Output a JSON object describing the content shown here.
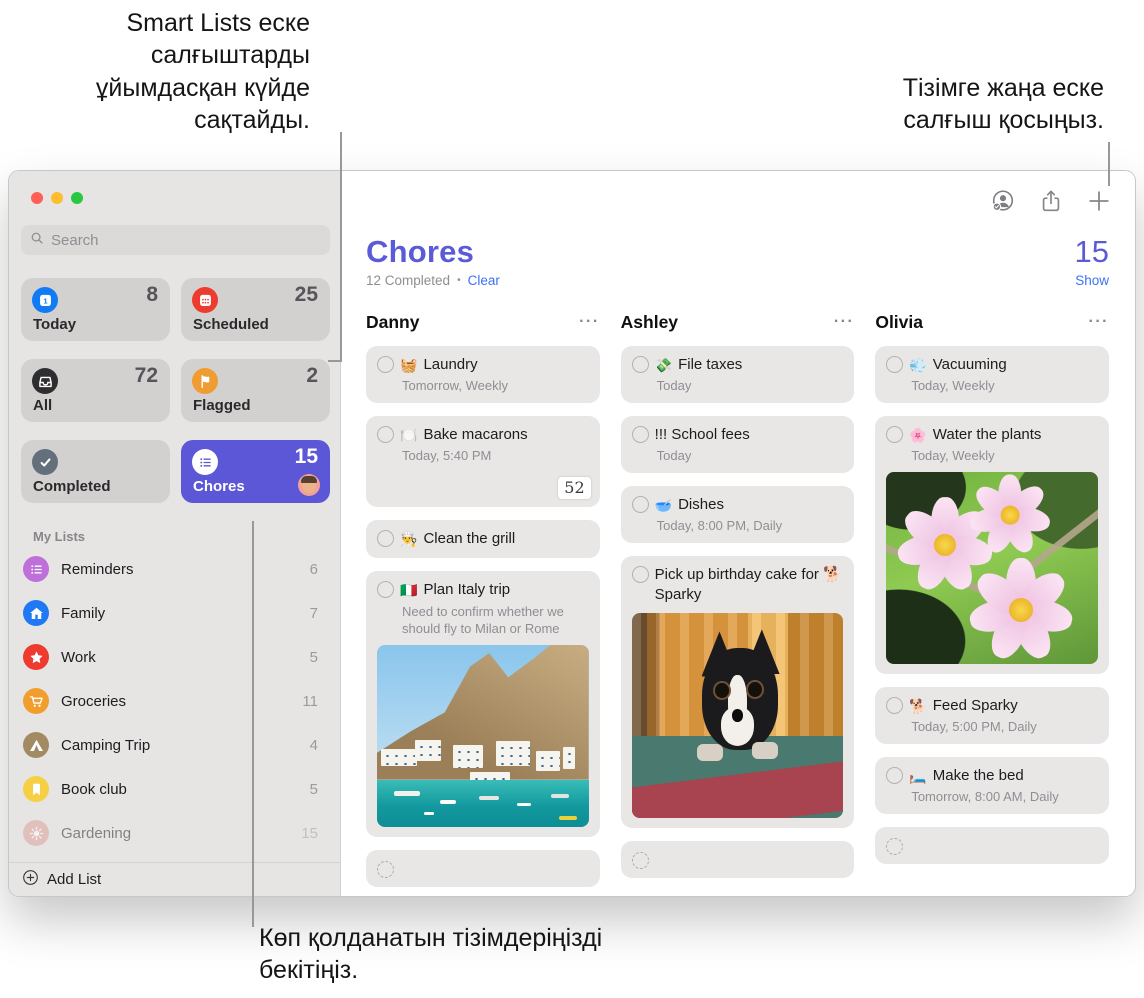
{
  "annotations": {
    "smart_lists": "Smart Lists еске салғыштарды ұйымдасқан күйде сақтайды.",
    "add_reminder": "Тізімге жаңа еске салғыш қосыңыз.",
    "pin_lists": "Көп қолданатын тізімдеріңізді бекітіңіз."
  },
  "colors": {
    "accent_indigo": "#5b57d6",
    "link_blue": "#3b72f2",
    "traffic": [
      "#ff5f57",
      "#febc2e",
      "#28c840"
    ]
  },
  "sidebar": {
    "search_placeholder": "Search",
    "smart_lists": [
      {
        "label": "Today",
        "count": "8",
        "color": "#107bf5",
        "icon": "calendar-today",
        "selected": false
      },
      {
        "label": "Scheduled",
        "count": "25",
        "color": "#ee3b2f",
        "icon": "calendar-grid",
        "selected": false
      },
      {
        "label": "All",
        "count": "72",
        "color": "#2e2e30",
        "icon": "tray",
        "selected": false
      },
      {
        "label": "Flagged",
        "count": "2",
        "color": "#ef9c33",
        "icon": "flag",
        "selected": false
      },
      {
        "label": "Completed",
        "count": "",
        "color": "#63707b",
        "icon": "check",
        "selected": false
      },
      {
        "label": "Chores",
        "count": "15",
        "color": "#5b57d6",
        "icon": "list",
        "selected": true
      }
    ],
    "my_lists_label": "My Lists",
    "my_lists": [
      {
        "label": "Reminders",
        "count": "6",
        "color": "#bf6fd9",
        "icon": "list",
        "faded": false
      },
      {
        "label": "Family",
        "count": "7",
        "color": "#2079f4",
        "icon": "house",
        "faded": false
      },
      {
        "label": "Work",
        "count": "5",
        "color": "#ee3b2f",
        "icon": "star",
        "faded": false
      },
      {
        "label": "Groceries",
        "count": "11",
        "color": "#f09f2e",
        "icon": "cart",
        "faded": false
      },
      {
        "label": "Camping Trip",
        "count": "4",
        "color": "#a28a63",
        "icon": "tent",
        "faded": false
      },
      {
        "label": "Book club",
        "count": "5",
        "color": "#f6cf45",
        "icon": "bookmark",
        "faded": false
      },
      {
        "label": "Gardening",
        "count": "15",
        "color": "#dd9c95",
        "icon": "sun",
        "faded": true
      }
    ],
    "add_list_label": "Add List"
  },
  "toolbar": {
    "icons": [
      "collaborate",
      "share",
      "add-reminder"
    ]
  },
  "header": {
    "title": "Chores",
    "completed_text": "12 Completed",
    "separator": "•",
    "clear_link": "Clear",
    "count": "15",
    "show_link": "Show"
  },
  "columns": [
    {
      "name": "Danny",
      "more": "···",
      "items": [
        {
          "emoji": "🧺",
          "title": "Laundry",
          "subtitle": "Tomorrow, Weekly"
        },
        {
          "emoji": "🍽️",
          "title": "Bake macarons",
          "subtitle": "Today, 5:40 PM",
          "badge": "52"
        },
        {
          "emoji": "👨‍🍳",
          "title": "Clean the grill"
        },
        {
          "emoji": "🇮🇹",
          "title": "Plan Italy trip",
          "note": "Need to confirm whether we should fly to Milan or Rome",
          "image": "italy-coast"
        },
        {
          "empty": true
        }
      ]
    },
    {
      "name": "Ashley",
      "more": "···",
      "items": [
        {
          "emoji": "💸",
          "title": "File taxes",
          "subtitle": "Today"
        },
        {
          "title": "!!! School fees",
          "subtitle": "Today"
        },
        {
          "emoji": "🥣",
          "title": "Dishes",
          "subtitle": "Today, 8:00 PM, Daily"
        },
        {
          "title": "Pick up birthday cake for 🐕 Sparky",
          "image": "dog-on-rug"
        },
        {
          "empty": true
        }
      ]
    },
    {
      "name": "Olivia",
      "more": "···",
      "items": [
        {
          "emoji": "💨",
          "title": "Vacuuming",
          "subtitle": "Today, Weekly"
        },
        {
          "emoji": "🌸",
          "title": "Water the plants",
          "subtitle": "Today, Weekly",
          "image": "pink-flowers"
        },
        {
          "emoji": "🐕",
          "title": "Feed Sparky",
          "subtitle": "Today, 5:00 PM, Daily"
        },
        {
          "emoji": "🛏️",
          "title": "Make the bed",
          "subtitle": "Tomorrow, 8:00 AM, Daily"
        },
        {
          "empty": true
        }
      ]
    }
  ]
}
